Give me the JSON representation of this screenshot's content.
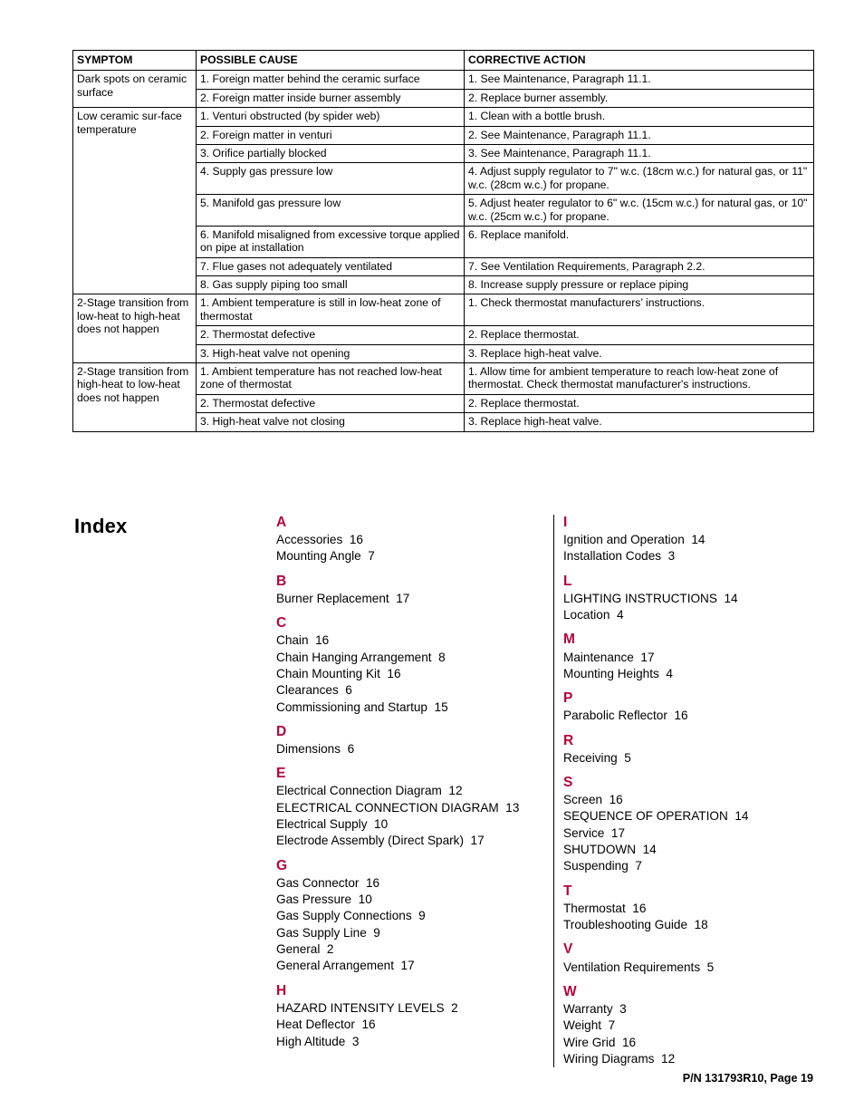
{
  "table": {
    "headers": [
      "SYMPTOM",
      "POSSIBLE CAUSE",
      "CORRECTIVE ACTION"
    ],
    "groups": [
      {
        "symptom": "Dark spots on ceramic surface",
        "rows": [
          {
            "cause": "1. Foreign matter behind the ceramic surface",
            "action": "1. See Maintenance, Paragraph 11.1."
          },
          {
            "cause": "2. Foreign matter inside burner assembly",
            "action": "2. Replace burner assembly."
          }
        ]
      },
      {
        "symptom": "Low ceramic sur-face temperature",
        "rows": [
          {
            "cause": "1. Venturi obstructed (by spider web)",
            "action": "1. Clean with a bottle brush."
          },
          {
            "cause": "2. Foreign matter in venturi",
            "action": "2. See Maintenance, Paragraph 11.1."
          },
          {
            "cause": "3. Orifice partially blocked",
            "action": "3. See Maintenance, Paragraph 11.1."
          },
          {
            "cause": "4. Supply gas pressure low",
            "action": "4. Adjust supply regulator to 7\" w.c. (18cm w.c.) for natural gas, or 11\" w.c. (28cm w.c.) for propane."
          },
          {
            "cause": "5. Manifold gas pressure low",
            "action": "5. Adjust heater regulator to 6\" w.c. (15cm w.c.) for natural gas, or 10\" w.c. (25cm w.c.) for propane."
          },
          {
            "cause": "6. Manifold misaligned from excessive torque applied on pipe at installation",
            "action": "6. Replace manifold."
          },
          {
            "cause": "7. Flue gases not adequately ventilated",
            "action": "7. See Ventilation Requirements, Paragraph 2.2."
          },
          {
            "cause": "8. Gas supply piping too small",
            "action": "8. Increase supply pressure or replace piping"
          }
        ]
      },
      {
        "symptom": "2-Stage transition from low-heat to high-heat does not happen",
        "rows": [
          {
            "cause": "1. Ambient temperature is still in low-heat zone of thermostat",
            "action": "1. Check thermostat manufacturers’ instructions."
          },
          {
            "cause": "2. Thermostat defective",
            "action": "2. Replace thermostat."
          },
          {
            "cause": "3. High-heat valve not opening",
            "action": "3. Replace high-heat valve."
          }
        ]
      },
      {
        "symptom": "2-Stage transition from high-heat to low-heat does not happen",
        "rows": [
          {
            "cause": "1. Ambient temperature has not reached low-heat zone of thermostat",
            "action": "1. Allow time for ambient temperature to reach low-heat zone of thermostat. Check thermostat manufacturer's instructions."
          },
          {
            "cause": "2. Thermostat defective",
            "action": "2. Replace thermostat."
          },
          {
            "cause": "3. High-heat valve not closing",
            "action": "3. Replace high-heat valve."
          }
        ]
      }
    ]
  },
  "index": {
    "title": "Index",
    "accent_color": "#b3053a",
    "left_column": [
      {
        "letter": "A",
        "entries": [
          "Accessories  16",
          "Mounting Angle  7"
        ]
      },
      {
        "letter": "B",
        "entries": [
          "Burner Replacement  17"
        ]
      },
      {
        "letter": "C",
        "entries": [
          "Chain  16",
          "Chain Hanging Arrangement  8",
          "Chain Mounting Kit  16",
          "Clearances  6",
          "Commissioning and Startup  15"
        ]
      },
      {
        "letter": "D",
        "entries": [
          "Dimensions  6"
        ]
      },
      {
        "letter": "E",
        "entries": [
          "Electrical Connection Diagram  12",
          "ELECTRICAL CONNECTION DIAGRAM  13",
          "Electrical Supply  10",
          "Electrode Assembly (Direct Spark)  17"
        ]
      },
      {
        "letter": "G",
        "entries": [
          "Gas Connector  16",
          "Gas Pressure  10",
          "Gas Supply Connections  9",
          "Gas Supply Line  9",
          "General  2",
          "General Arrangement  17"
        ]
      },
      {
        "letter": "H",
        "entries": [
          "HAZARD INTENSITY LEVELS  2",
          "Heat Deflector  16",
          "High Altitude  3"
        ]
      }
    ],
    "right_column": [
      {
        "letter": "I",
        "entries": [
          "Ignition and Operation  14",
          "Installation Codes  3"
        ]
      },
      {
        "letter": "L",
        "entries": [
          "LIGHTING INSTRUCTIONS  14",
          "Location  4"
        ]
      },
      {
        "letter": "M",
        "entries": [
          "Maintenance  17",
          "Mounting Heights  4"
        ]
      },
      {
        "letter": "P",
        "entries": [
          "Parabolic Reflector  16"
        ]
      },
      {
        "letter": "R",
        "entries": [
          "Receiving  5"
        ]
      },
      {
        "letter": "S",
        "entries": [
          "Screen  16",
          "SEQUENCE OF OPERATION  14",
          "Service  17",
          "SHUTDOWN  14",
          "Suspending  7"
        ]
      },
      {
        "letter": "T",
        "entries": [
          "Thermostat  16",
          "Troubleshooting Guide  18"
        ]
      },
      {
        "letter": "V",
        "entries": [
          "Ventilation Requirements  5"
        ]
      },
      {
        "letter": "W",
        "entries": [
          "Warranty  3",
          "Weight  7",
          "Wire Grid  16",
          "Wiring Diagrams  12"
        ]
      }
    ]
  },
  "footer": {
    "text": "P/N 131793R10, Page 19"
  }
}
